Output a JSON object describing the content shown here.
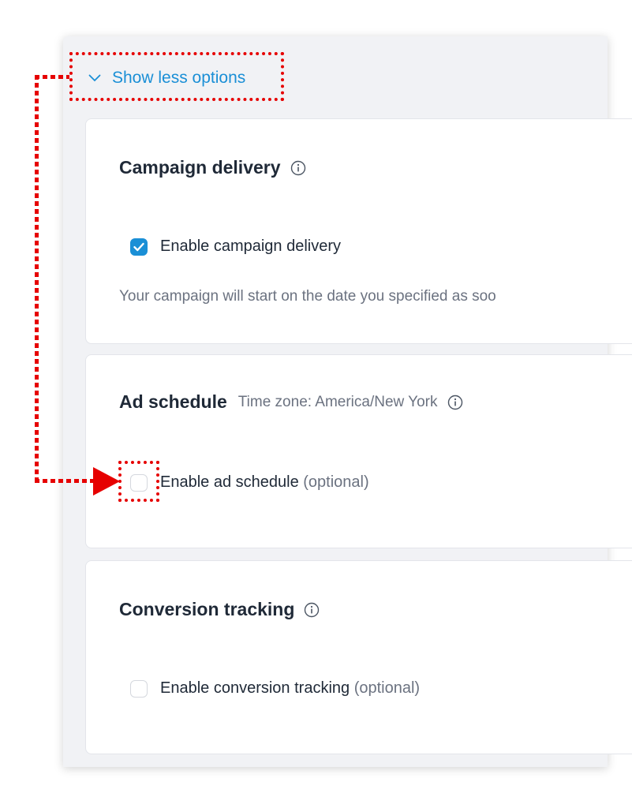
{
  "toggle": {
    "label": "Show less options",
    "icon": "chevron-down-icon"
  },
  "campaign_delivery": {
    "title": "Campaign delivery",
    "checkbox_label": "Enable campaign delivery",
    "checked": true,
    "description": "Your campaign will start on the date you specified as soo"
  },
  "ad_schedule": {
    "title": "Ad schedule",
    "subtitle": "Time zone: America/New York",
    "checkbox_label": "Enable ad schedule",
    "optional": "(optional)",
    "checked": false
  },
  "conversion_tracking": {
    "title": "Conversion tracking",
    "checkbox_label": "Enable conversion tracking",
    "optional": "(optional)",
    "checked": false
  },
  "colors": {
    "accent": "#1a8fd6",
    "annotation": "#e60000",
    "panel_bg": "#f1f2f5"
  }
}
